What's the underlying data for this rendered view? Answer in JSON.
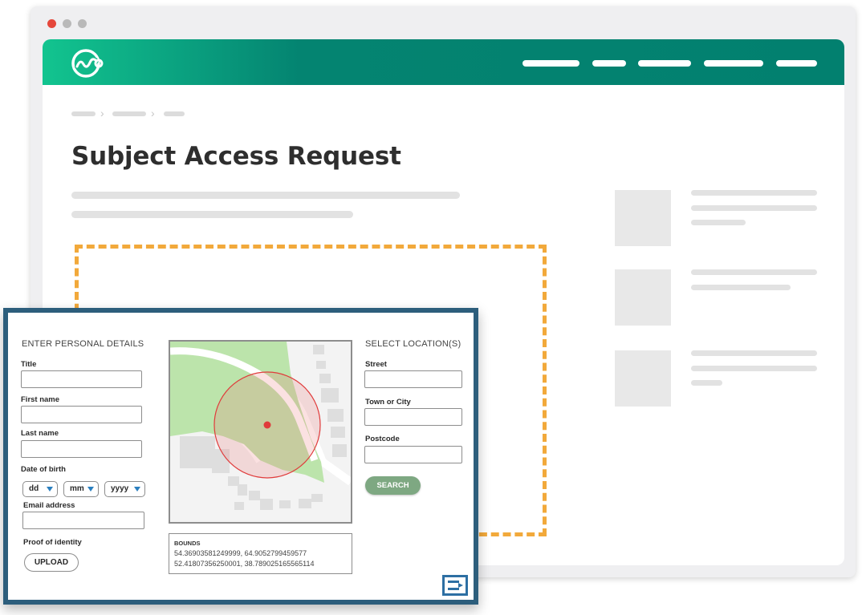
{
  "page": {
    "title": "Subject Access Request"
  },
  "browser": {
    "window_dots": [
      "#e5473b",
      "#b9b9b9",
      "#b9b9b9"
    ]
  },
  "header": {
    "logo": "brand-logo-icon",
    "brand_colors": [
      "#12c48f",
      "#02806f"
    ],
    "nav_links": 5
  },
  "form": {
    "personal_details": {
      "heading": "ENTER PERSONAL DETAILS",
      "title_label": "Title",
      "title_value": "",
      "first_name_label": "First name",
      "first_name_value": "",
      "last_name_label": "Last name",
      "last_name_value": "",
      "dob_label": "Date of birth",
      "dob_day": "dd",
      "dob_month": "mm",
      "dob_year": "yyyy",
      "email_label": "Email address",
      "email_value": "",
      "proof_label": "Proof of identity",
      "upload_label": "UPLOAD"
    },
    "map": {
      "bounds_heading": "BOUNDS",
      "bounds_line1": "54.36903581249999, 64.9052799459577",
      "bounds_line2": "52.41807356250001, 38.789025165565114"
    },
    "location": {
      "heading": "SELECT LOCATION(S)",
      "street_label": "Street",
      "street_value": "",
      "town_label": "Town or City",
      "town_value": "",
      "postcode_label": "Postcode",
      "postcode_value": "",
      "search_label": "SEARCH"
    },
    "accent_color": "#2d5e7c",
    "search_button_color": "#7ea882"
  }
}
